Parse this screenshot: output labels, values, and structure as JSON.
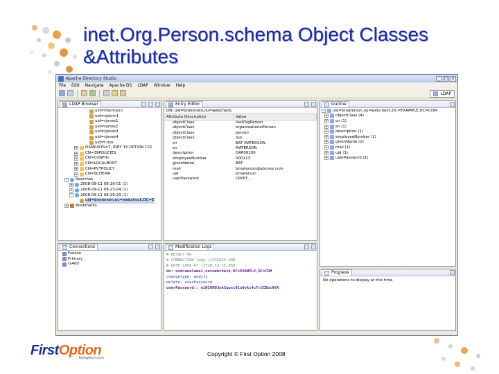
{
  "slide": {
    "title_line1": "inet.Org.Person.schema Object Classes",
    "title_line2": "&Attributes",
    "copyright": "Copyright © First Option 2008"
  },
  "logo": {
    "brand_part1": "First",
    "brand_part2": "Option",
    "site": "firstoption.com",
    "brand_color": "#1c2f8a",
    "accent_color": "#e46a1a"
  },
  "window": {
    "title": "Apache Directory Studio",
    "perspective": "LDAP"
  },
  "menu": [
    "File",
    "Edit",
    "Navigate",
    "Apache DS",
    "LDAP",
    "Window",
    "Help"
  ],
  "ldap_browser": {
    "tab": "LDAP Browser",
    "items": [
      {
        "label": "uid=rhermann",
        "indent": 5,
        "type": "entry",
        "expander": ""
      },
      {
        "label": "uid=rjohnn1",
        "indent": 5,
        "type": "entry",
        "expander": ""
      },
      {
        "label": "uid=rjones1",
        "indent": 5,
        "type": "entry",
        "expander": ""
      },
      {
        "label": "uid=rjones2",
        "indent": 5,
        "type": "entry",
        "expander": ""
      },
      {
        "label": "uid=rjones3",
        "indent": 5,
        "type": "entry",
        "expander": ""
      },
      {
        "label": "uid=rjones4",
        "indent": 5,
        "type": "entry",
        "expander": ""
      },
      {
        "label": "uid=t.oos",
        "indent": 5,
        "type": "entry",
        "expander": ""
      },
      {
        "label": "OSMIUSYS=T, IDEY 15 OPTION COI",
        "indent": 3,
        "type": "folder",
        "expander": "+"
      },
      {
        "label": "CN=39POLICIES",
        "indent": 3,
        "type": "folder",
        "expander": "+"
      },
      {
        "label": "CN=CONFIG",
        "indent": 3,
        "type": "folder",
        "expander": "+"
      },
      {
        "label": "CN=LOCALHOST",
        "indent": 3,
        "type": "folder",
        "expander": "+"
      },
      {
        "label": "CN=PVTPOLICY",
        "indent": 3,
        "type": "folder",
        "expander": "+"
      },
      {
        "label": "CN=SCHEMA",
        "indent": 3,
        "type": "folder",
        "expander": "+"
      },
      {
        "label": "Searches",
        "indent": 1,
        "type": "search",
        "expander": "-"
      },
      {
        "label": "2008-09-11 08-29-01 (1)",
        "indent": 2,
        "type": "search",
        "expander": "+"
      },
      {
        "label": "2008-09-11 08-23-04 (1)",
        "indent": 2,
        "type": "search",
        "expander": "+"
      },
      {
        "label": "2008-09-11 08-29-23 (1)",
        "indent": 2,
        "type": "search",
        "expander": "-"
      },
      {
        "label": "uid=bnetersen,ou=webcheck,DC=E",
        "indent": 3,
        "type": "entry",
        "expander": "",
        "selected": true
      },
      {
        "label": "Bookmarks",
        "indent": 1,
        "type": "bm",
        "expander": "+"
      }
    ]
  },
  "entry_editor": {
    "tab": "Entry Editor",
    "dn": "DN: uid=bnetersen,ou=webcheck,",
    "col_attr": "Attribute Description",
    "col_value": "Value",
    "rows": [
      {
        "attr": "objectClass",
        "value": "inetOrgPerson",
        "oc": true
      },
      {
        "attr": "objectClass",
        "value": "organizationalPerson",
        "oc": true
      },
      {
        "attr": "objectClass",
        "value": "person",
        "oc": true
      },
      {
        "attr": "objectClass",
        "value": "top",
        "oc": true
      },
      {
        "attr": "cn",
        "value": "BAT          MATERSON",
        "oc": false
      },
      {
        "attr": "sn",
        "value": "MATERSON",
        "oc": false
      },
      {
        "attr": "description",
        "value": "DAP00100",
        "oc": false
      },
      {
        "attr": "employeeNumber",
        "value": "000123",
        "oc": false
      },
      {
        "attr": "givenName",
        "value": "BAT",
        "oc": false
      },
      {
        "attr": "mail",
        "value": "bmaterson@abcnex.com",
        "oc": false
      },
      {
        "attr": "uid",
        "value": "bmaterson",
        "oc": false
      },
      {
        "attr": "userPassword",
        "value": "CRYPT ...",
        "oc": false
      }
    ]
  },
  "outline": {
    "tab": "Outline",
    "root": "uid=bmaterson,ou=webcheck,DC=EXAMPLE,DC=COM",
    "items": [
      "objectClass (4)",
      "cn (1)",
      "sn (1)",
      "description (1)",
      "employeeNumber (1)",
      "givenName (1)",
      "mail (1)",
      "uid (1)",
      "userPassword (1)"
    ]
  },
  "connections": {
    "tab": "Connections",
    "items": [
      "Fsense",
      "Primary",
      "rx400"
    ]
  },
  "modification_logs": {
    "tab": "Modification Logs",
    "lines": [
      {
        "cls": "cm",
        "text": "# RESULT OK"
      },
      {
        "cls": "cm",
        "text": "# CONNECTION ldap://POIDSV:389"
      },
      {
        "cls": "cm",
        "text": "# DATE 2008-07-11T10:53:55.050"
      },
      {
        "cls": "key",
        "text": "dn: uid=analame1,ou=webcheck,DC=EXAMPLE,DC=COM"
      },
      {
        "cls": "val",
        "text": "changetype: modify"
      },
      {
        "cls": "val",
        "text": "delete: userPassword"
      },
      {
        "cls": "key",
        "text": "userPassword:: e1NIOHO3okCupsc01x0vkc4cTr2CDbcNYA"
      },
      {
        "cls": "val",
        "text": "-"
      }
    ]
  },
  "progress": {
    "tab": "Progress",
    "message": "No operations to display at this time."
  }
}
